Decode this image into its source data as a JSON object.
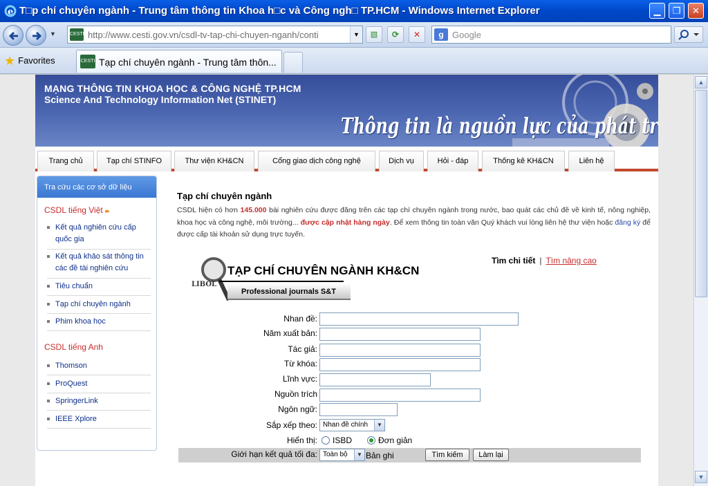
{
  "window": {
    "title": "T□p chí chuyên ngành - Trung tâm thông tin Khoa h□c và Công ngh□ TP.HCM - Windows Internet Explorer"
  },
  "navbar": {
    "url": "http://www.cesti.gov.vn/csdl-tv-tap-chi-chuyen-nganh/conti",
    "search_placeholder": "Google"
  },
  "tabbar": {
    "favorites_label": "Favorites",
    "tab_title": "Tạp chí chuyên ngành - Trung tâm thôn..."
  },
  "banner": {
    "line1": "MẠNG THÔNG TIN KHOA HỌC & CÔNG NGHỆ TP.HCM",
    "line2": "Science And Technology Information Net (STINET)",
    "slogan": "Thông tin là nguồn lực của phát triển"
  },
  "menu": [
    "Trang chủ",
    "Tạp chí STINFO",
    "Thư viện KH&CN",
    "Cổng giao dịch công nghệ",
    "Dịch vụ",
    "Hỏi - đáp",
    "Thống kê KH&CN",
    "Liên hệ"
  ],
  "sidebar": {
    "header": "Tra cứu các cơ sở dữ liệu",
    "group_vn": "CSDL tiếng Việt",
    "group_vn_arrow": "▸▸",
    "items_vn": [
      "Kết quả nghiên cứu cấp quốc gia",
      "Kết quả khảo sát thông tin các đề tài nghiên cứu",
      "Tiêu chuẩn",
      "Tạp chí chuyên ngành",
      "Phim khoa học"
    ],
    "group_en": "CSDL tiếng Anh",
    "items_en": [
      "Thomson",
      "ProQuest",
      "SpringerLink",
      "IEEE Xplore"
    ]
  },
  "main": {
    "title": "Tạp chí chuyên ngành",
    "intro_1": "CSDL hiện có hơn ",
    "intro_count": "145.000",
    "intro_2": " bài nghiên cứu được đăng trên các tạp chí chuyên ngành trong nước, bao quát các chủ đề về kinh tế, nông nghiệp, khoa học và công nghệ, môi trường... ",
    "intro_update": "được cập nhật hàng ngày",
    "intro_3": ". Để xem thông tin toàn văn Quý khách vui lòng liên hệ thư viện hoặc ",
    "intro_register": "đăng ký",
    "intro_4": " để được cấp tài khoản sử dụng trực tuyến.",
    "logo_title": "TẠP CHÍ CHUYÊN NGÀNH KH&CN",
    "logo_sub": "Professional journals S&T",
    "logo_libol": "LIBOL",
    "search_detail": "Tìm chi tiết",
    "search_sep": "|",
    "search_advanced": "Tìm nâng cao"
  },
  "form": {
    "title_label": "Nhan đề:",
    "year_label": "Năm xuất bản:",
    "author_label": "Tác giả:",
    "keyword_label": "Từ khóa:",
    "field_label": "Lĩnh vực:",
    "source_label": "Nguồn trích",
    "language_label": "Ngôn ngữ:",
    "sort_label": "Sắp xếp theo:",
    "sort_value": "Nhan đề chính",
    "display_label": "Hiển thị:",
    "display_isbd": "ISBD",
    "display_simple": "Đơn giản",
    "limit_label": "Giới hạn kết quả tối đa:",
    "limit_value": "Toàn bộ",
    "limit_unit": "Bản ghi",
    "search_button": "Tìm kiếm",
    "reset_button": "Làm lại"
  },
  "colors": {
    "titlebar": "#0047c9",
    "menu_underline": "#c2482e",
    "sidebar_header": "#3b77d2",
    "accent_red": "#c62c2c",
    "link_blue": "#0d2f8a"
  }
}
